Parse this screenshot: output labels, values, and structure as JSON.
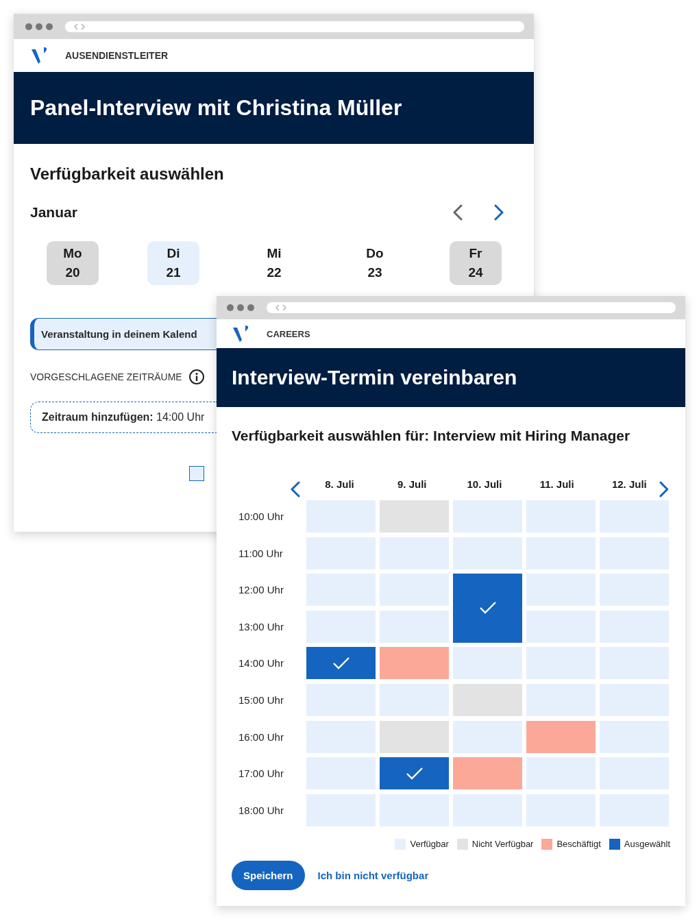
{
  "back_window": {
    "header_label": "AUSENDIENSTLEITER",
    "title": "Panel-Interview mit Christina Müller",
    "section_title": "Verfügbarkeit auswählen",
    "month": "Januar",
    "prev_button": {
      "disabled": true
    },
    "next_button": {
      "disabled": false
    },
    "days": [
      {
        "weekday": "Mo",
        "date": "20",
        "kind": "unavailable"
      },
      {
        "weekday": "Di",
        "date": "21",
        "kind": "available"
      },
      {
        "weekday": "Mi",
        "date": "22",
        "kind": "plain"
      },
      {
        "weekday": "Do",
        "date": "23",
        "kind": "plain"
      },
      {
        "weekday": "Fr",
        "date": "24",
        "kind": "unavailable"
      }
    ],
    "event_banner": "Veranstaltung in deinem Kalend",
    "suggested_label": "VORGESCHLAGENE ZEITRÄUME",
    "add_slot": "**Zeitraum hinzufügen:** 14:00 Uhr",
    "checkbox": {
      "checked": false
    }
  },
  "front_window": {
    "header_label": "CAREERS",
    "title": "Interview-Termin vereinbaren",
    "section_title": "Verfügbarkeit auswählen für: Interview mit Hiring Manager",
    "times": [
      "10:00 Uhr",
      "11:00 Uhr",
      "12:00 Uhr",
      "13:00 Uhr",
      "14:00 Uhr",
      "15:00 Uhr",
      "16:00 Uhr",
      "17:00 Uhr",
      "18:00 Uhr"
    ],
    "columns": [
      {
        "label": "8. Juli",
        "slots": [
          {
            "kind": "available"
          },
          {
            "kind": "available"
          },
          {
            "kind": "available"
          },
          {
            "kind": "available"
          },
          {
            "kind": "selected"
          },
          {
            "kind": "available"
          },
          {
            "kind": "available"
          },
          {
            "kind": "available"
          },
          {
            "kind": "available"
          }
        ]
      },
      {
        "label": "9. Juli",
        "slots": [
          {
            "kind": "unavailable"
          },
          {
            "kind": "available"
          },
          {
            "kind": "available"
          },
          {
            "kind": "available"
          },
          {
            "kind": "busy"
          },
          {
            "kind": "available"
          },
          {
            "kind": "unavailable"
          },
          {
            "kind": "selected"
          },
          {
            "kind": "available"
          }
        ]
      },
      {
        "label": "10. Juli",
        "slots": [
          {
            "kind": "available"
          },
          {
            "kind": "available"
          },
          {
            "kind": "selected"
          },
          {
            "kind": "selected"
          },
          {
            "kind": "available"
          },
          {
            "kind": "unavailable"
          },
          {
            "kind": "available"
          },
          {
            "kind": "busy"
          },
          {
            "kind": "available"
          }
        ]
      },
      {
        "label": "11. Juli",
        "slots": [
          {
            "kind": "available"
          },
          {
            "kind": "available"
          },
          {
            "kind": "available"
          },
          {
            "kind": "available"
          },
          {
            "kind": "available"
          },
          {
            "kind": "available"
          },
          {
            "kind": "busy"
          },
          {
            "kind": "available"
          },
          {
            "kind": "available"
          }
        ]
      },
      {
        "label": "12. Juli",
        "slots": [
          {
            "kind": "available"
          },
          {
            "kind": "available"
          },
          {
            "kind": "available"
          },
          {
            "kind": "available"
          },
          {
            "kind": "available"
          },
          {
            "kind": "available"
          },
          {
            "kind": "available"
          },
          {
            "kind": "available"
          },
          {
            "kind": "available"
          }
        ]
      }
    ],
    "legend": [
      {
        "kind": "available",
        "label": "Verfügbar"
      },
      {
        "kind": "unavailable",
        "label": "Nicht Verfügbar"
      },
      {
        "kind": "busy",
        "label": "Beschäftigt"
      },
      {
        "kind": "selected",
        "label": "Ausgewählt"
      }
    ],
    "save_button": "Speichern",
    "unavailable_link": "Ich bin nicht verfügbar"
  }
}
